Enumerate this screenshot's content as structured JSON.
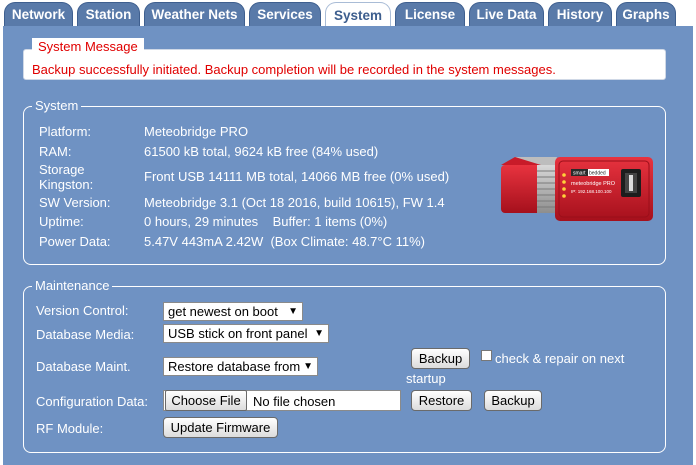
{
  "tabs": [
    {
      "label": "Network",
      "active": false
    },
    {
      "label": "Station",
      "active": false
    },
    {
      "label": "Weather Nets",
      "active": false
    },
    {
      "label": "Services",
      "active": false
    },
    {
      "label": "System",
      "active": true
    },
    {
      "label": "License",
      "active": false
    },
    {
      "label": "Live Data",
      "active": false
    },
    {
      "label": "History",
      "active": false
    },
    {
      "label": "Graphs",
      "active": false
    }
  ],
  "system_message": {
    "title": "System Message",
    "text": "Backup successfully initiated. Backup completion will be recorded in the system messages."
  },
  "system": {
    "legend": "System",
    "rows": [
      {
        "label": "Platform:",
        "value": "Meteobridge PRO"
      },
      {
        "label": "RAM:",
        "value": "61500 kB total, 9624 kB free (84% used)"
      },
      {
        "label_line1": "Storage",
        "label_line2": "Kingston:",
        "value": "Front USB 14111 MB total, 14066 MB free (0% used)"
      },
      {
        "label": "SW Version:",
        "value": "Meteobridge 3.1 (Oct 18 2016, build 10615), FW 1.4"
      },
      {
        "label": "Uptime:",
        "value": "0 hours, 29 minutes    Buffer: 1 items (0%)"
      },
      {
        "label": "Power Data:",
        "value": "5.47V 443mA 2.42W  (Box Climate: 48.7°C 11%)"
      }
    ],
    "device_text": {
      "brand_left": "smart",
      "brand_right": "bedded",
      "model": "meteobridge PRO",
      "ip": "IP: 192.168.100.100"
    }
  },
  "maintenance": {
    "legend": "Maintenance",
    "version_control": {
      "label": "Version Control:",
      "selected": "get newest on boot"
    },
    "database_media": {
      "label": "Database Media:",
      "selected": "USB stick on front panel"
    },
    "database_maint": {
      "label": "Database Maint.",
      "selected": "Restore database from",
      "backup_label": "Backup",
      "check_label": "check & repair on next",
      "check_label_line2": "startup",
      "checked": false
    },
    "configuration_data": {
      "label": "Configuration Data:",
      "choose_file_label": "Choose File",
      "file_status": "No file chosen",
      "restore_label": "Restore",
      "backup_label": "Backup"
    },
    "rf_module": {
      "label": "RF Module:",
      "button_label": "Update Firmware"
    }
  },
  "colors": {
    "panel_bg": "#6f92c3",
    "tab_bg": "#597aa9",
    "message_red": "#e00000",
    "device_red": "#d01c2c"
  }
}
